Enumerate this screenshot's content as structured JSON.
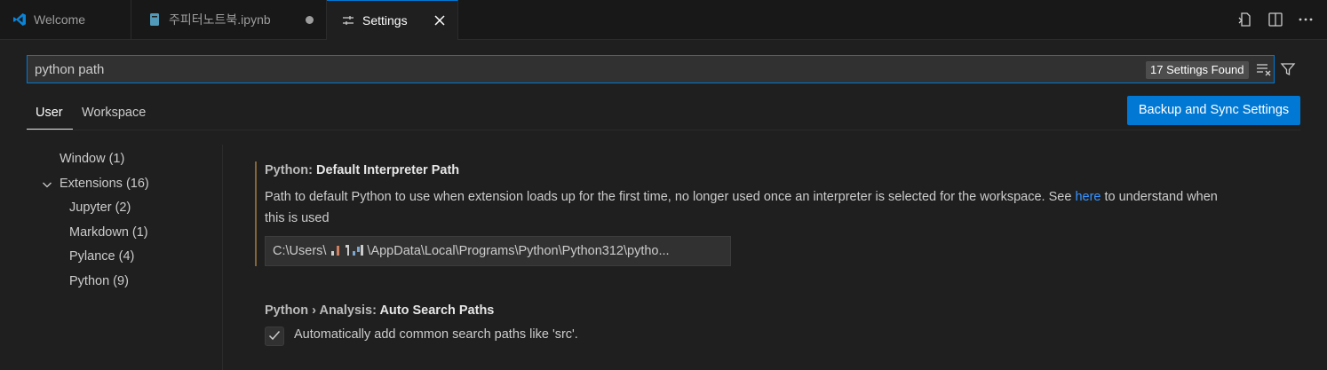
{
  "tabs": [
    {
      "label": "Welcome",
      "icon": "vscode-logo-icon"
    },
    {
      "label": "주피터노트북.ipynb",
      "icon": "notebook-icon",
      "dirty": true
    },
    {
      "label": "Settings",
      "icon": "settings-sliders-icon",
      "active": true
    }
  ],
  "editor_actions": [
    "open-settings-json-icon",
    "split-editor-icon",
    "more-actions-icon"
  ],
  "search": {
    "value": "python path",
    "result_badge": "17 Settings Found"
  },
  "scopes": {
    "user": "User",
    "workspace": "Workspace"
  },
  "sync_button": "Backup and Sync Settings",
  "toc": [
    {
      "label": "Window (1)"
    },
    {
      "label": "Extensions (16)"
    },
    {
      "label": "Jupyter (2)"
    },
    {
      "label": "Markdown (1)"
    },
    {
      "label": "Pylance (4)"
    },
    {
      "label": "Python (9)"
    }
  ],
  "setting1": {
    "category": "Python: ",
    "name": "Default Interpreter Path",
    "description": "Path to default Python to use when extension loads up for the first time, no longer used once an interpreter is selected for the workspace. See ",
    "link": "here",
    "description_end": " to understand when this is used",
    "value_prefix": "C:\\Users\\",
    "value_suffix": "\\AppData\\Local\\Programs\\Python\\Python312\\pytho..."
  },
  "setting2": {
    "category": "Python › Analysis: ",
    "name": "Auto Search Paths",
    "checkbox_label": "Automatically add common search paths like 'src'.",
    "checked": true
  },
  "colors": {
    "accent": "#0078d4",
    "link": "#3794ff",
    "modified_marker": "#d3a052",
    "background": "#1f1f1f"
  }
}
